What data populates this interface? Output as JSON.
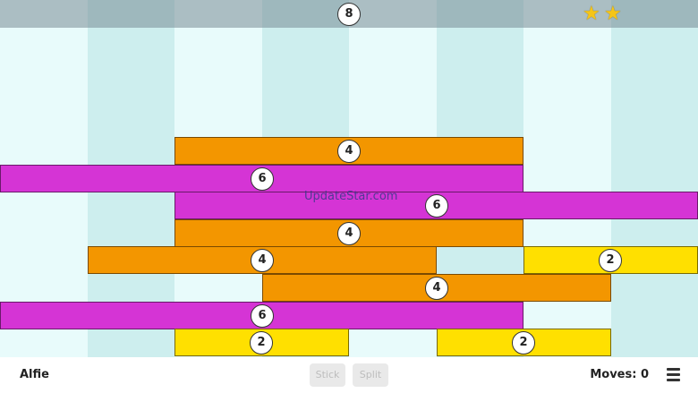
{
  "header": {
    "target": "8",
    "stars": [
      "★",
      "★"
    ],
    "star_icon": "star-icon"
  },
  "board": {
    "rods": [
      {
        "value": "4",
        "color": "orange"
      },
      {
        "value": "6",
        "color": "magenta"
      },
      {
        "value": "6",
        "color": "magenta"
      },
      {
        "value": "4",
        "color": "orange"
      },
      {
        "value": "4",
        "color": "orange"
      },
      {
        "value": "2",
        "color": "yellow"
      },
      {
        "value": "4",
        "color": "orange"
      },
      {
        "value": "6",
        "color": "magenta"
      },
      {
        "value": "2",
        "color": "yellow"
      },
      {
        "value": "2",
        "color": "yellow"
      }
    ],
    "watermark": "UpdateStar.com"
  },
  "footer": {
    "player": "Alfie",
    "stick_label": "Stick",
    "split_label": "Split",
    "moves": "Moves: 0",
    "menu_icon": "hamburger-menu-icon"
  },
  "colors": {
    "orange": "#f39600",
    "magenta": "#d534d5",
    "yellow": "#ffe000",
    "column_light": "#e8fbfb",
    "column_dark": "#cdeeee"
  }
}
